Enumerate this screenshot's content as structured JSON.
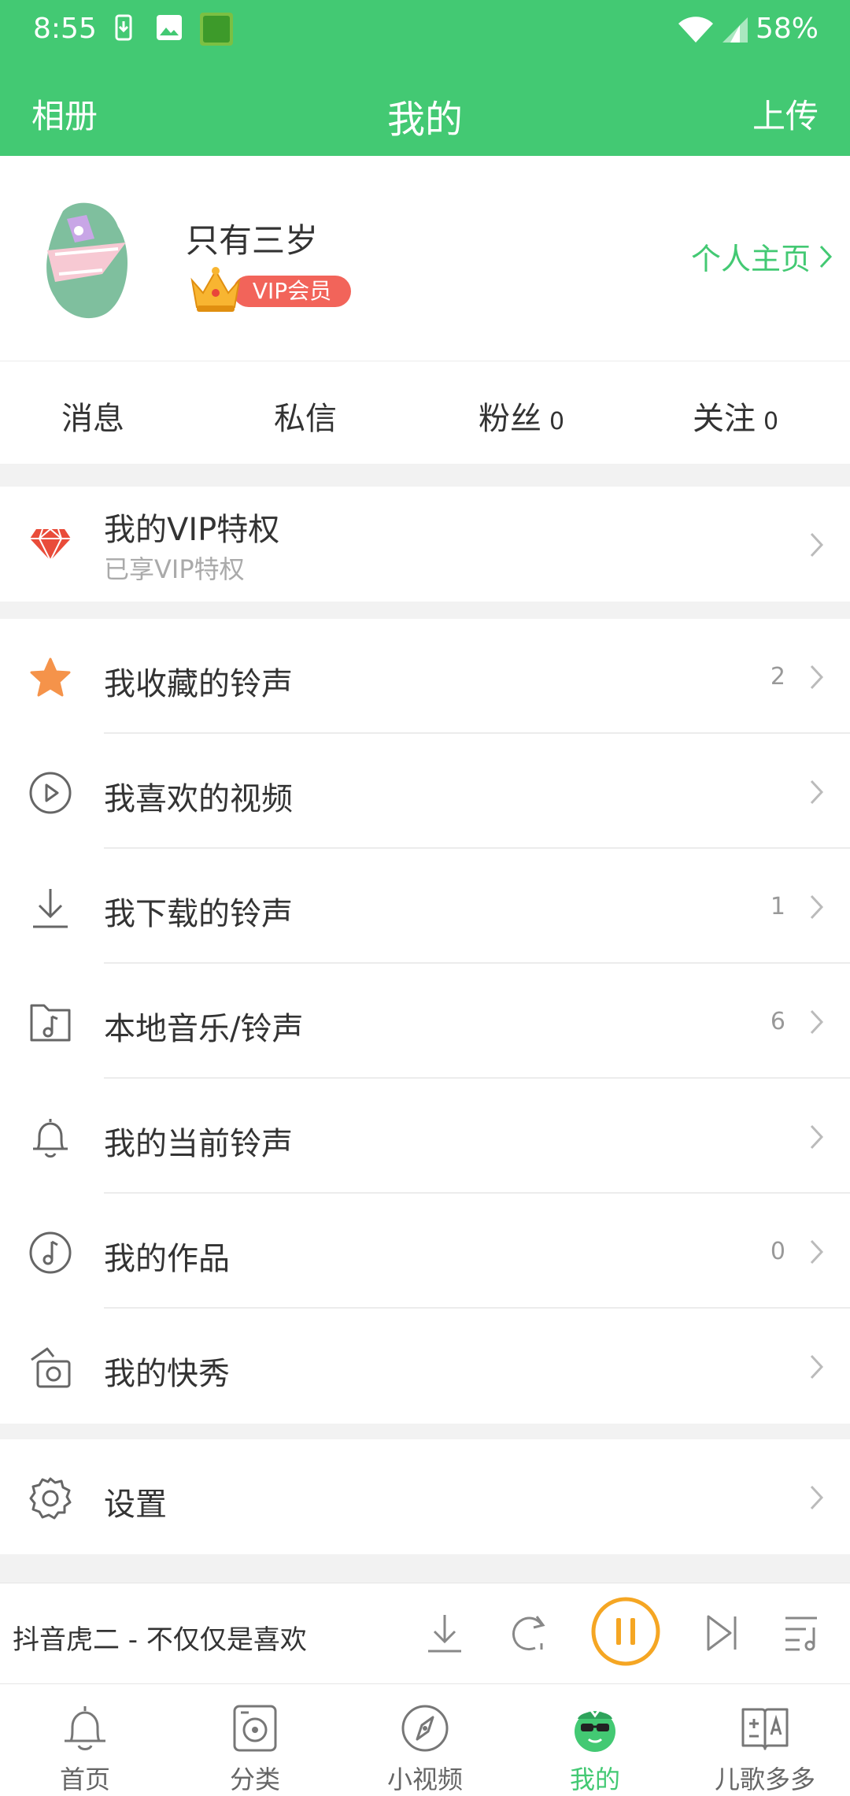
{
  "status": {
    "time": "8:55",
    "battery": "58%"
  },
  "header": {
    "left": "相册",
    "title": "我的",
    "right": "上传"
  },
  "profile": {
    "username": "只有三岁",
    "vip_badge": "VIP会员",
    "homepage_link": "个人主页"
  },
  "stats": [
    {
      "label": "消息",
      "count": ""
    },
    {
      "label": "私信",
      "count": ""
    },
    {
      "label": "粉丝",
      "count": "0"
    },
    {
      "label": "关注",
      "count": "0"
    }
  ],
  "vip": {
    "title": "我的VIP特权",
    "subtitle": "已享VIP特权"
  },
  "menu": [
    {
      "label": "我收藏的铃声",
      "count": "2",
      "icon": "star-icon"
    },
    {
      "label": "我喜欢的视频",
      "count": "",
      "icon": "play-circle-icon"
    },
    {
      "label": "我下载的铃声",
      "count": "1",
      "icon": "download-icon"
    },
    {
      "label": "本地音乐/铃声",
      "count": "6",
      "icon": "music-folder-icon"
    },
    {
      "label": "我的当前铃声",
      "count": "",
      "icon": "bell-icon"
    },
    {
      "label": "我的作品",
      "count": "0",
      "icon": "music-note-icon"
    },
    {
      "label": "我的快秀",
      "count": "",
      "icon": "camera-icon"
    }
  ],
  "settings": {
    "label": "设置"
  },
  "player": {
    "song": "抖音虎二 - 不仅仅是喜欢"
  },
  "tabs": [
    {
      "label": "首页",
      "icon": "bell-icon"
    },
    {
      "label": "分类",
      "icon": "category-icon"
    },
    {
      "label": "小视频",
      "icon": "compass-icon"
    },
    {
      "label": "我的",
      "icon": "mine-icon",
      "active": true
    },
    {
      "label": "儿歌多多",
      "icon": "book-icon"
    }
  ],
  "colors": {
    "accent": "#43c973",
    "vip": "#f2645a",
    "star": "#f5934a",
    "pause": "#f5a623"
  }
}
